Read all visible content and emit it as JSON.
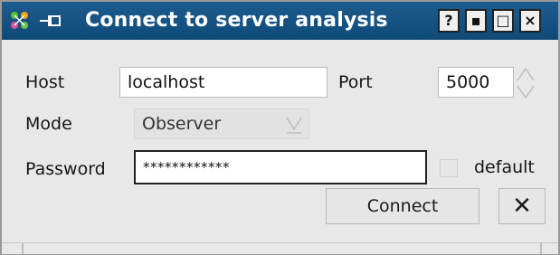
{
  "window": {
    "title": "Connect to server analysis",
    "buttons": {
      "help": "?",
      "minimize": "▪",
      "maximize": "□",
      "close": "×"
    }
  },
  "form": {
    "host_label": "Host",
    "host_value": "localhost",
    "port_label": "Port",
    "port_value": "5000",
    "mode_label": "Mode",
    "mode_value": "Observer",
    "password_label": "Password",
    "password_value": "************",
    "default_label": "default",
    "default_checked": false
  },
  "actions": {
    "connect_label": "Connect",
    "cancel_label": "✕"
  },
  "colors": {
    "titlebar": "#0f4a78",
    "titlebar_text": "#ffffff",
    "window_bg": "#e8e8e8"
  },
  "icons": {
    "app": "app-icon",
    "pin": "pin-icon",
    "spin_up": "spin-up-icon",
    "spin_down": "spin-down-icon",
    "dropdown": "dropdown-arrow-icon",
    "close": "close-icon"
  }
}
